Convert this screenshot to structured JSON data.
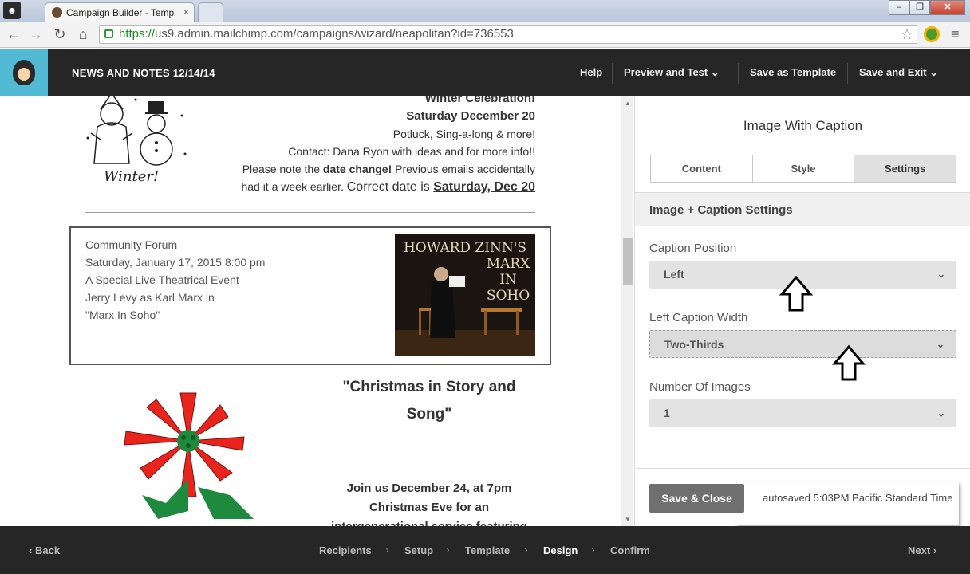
{
  "browser": {
    "tab_title": "Campaign Builder - Temp",
    "close_glyph": "×",
    "url_https": "https://",
    "url_rest": "us9.admin.mailchimp.com/campaigns/wizard/neapolitan?id=736553"
  },
  "header": {
    "campaign_name": "NEWS AND NOTES 12/14/14",
    "help": "Help",
    "preview": "Preview and Test",
    "save_template": "Save as Template",
    "save_exit": "Save and Exit"
  },
  "email": {
    "winter": {
      "heading": "Winter Celebration!",
      "date": "Saturday December 20",
      "line1": "Potluck, Sing-a-long & more!",
      "line2": "Contact: Dana Ryon with ideas and for more info!!",
      "line3_a": "Please note the ",
      "line3_b": "date change!",
      "line3_c": " Previous emails accidentally",
      "line4_a": "had it a week earlier. ",
      "line4_b": "Correct date is ",
      "line4_c": "Saturday, Dec 20",
      "img_caption": "Winter!"
    },
    "forum": {
      "line1": "Community Forum",
      "line2": "Saturday, January 17, 2015 8:00 pm",
      "line3": "A Special Live Theatrical Event",
      "line4": "Jerry Levy as Karl Marx in",
      "line5": "\"Marx In Soho\"",
      "img_line1": "HOWARD ZINN'S",
      "img_line2": "MARX",
      "img_line3": "IN",
      "img_line4": "SOHO"
    },
    "xmas": {
      "title_line1": "\"Christmas in Story and",
      "title_line2": "Song\"",
      "text_line1": "Join us December 24, at 7pm",
      "text_line2": "Christmas Eve for an",
      "text_line3": "intergenerational service featuring"
    }
  },
  "panel": {
    "title": "Image With Caption",
    "tabs": [
      "Content",
      "Style",
      "Settings"
    ],
    "section": "Image + Caption Settings",
    "caption_position_label": "Caption Position",
    "caption_position_value": "Left",
    "left_caption_width_label": "Left Caption Width",
    "left_caption_width_value": "Two-Thirds",
    "number_images_label": "Number Of Images",
    "number_images_value": "1",
    "save_close": "Save & Close",
    "autosave": "autosaved 5:03PM Pacific Standard Time"
  },
  "footer": {
    "back": "Back",
    "steps": [
      "Recipients",
      "Setup",
      "Template",
      "Design",
      "Confirm"
    ],
    "active_step": "Design",
    "next": "Next"
  }
}
